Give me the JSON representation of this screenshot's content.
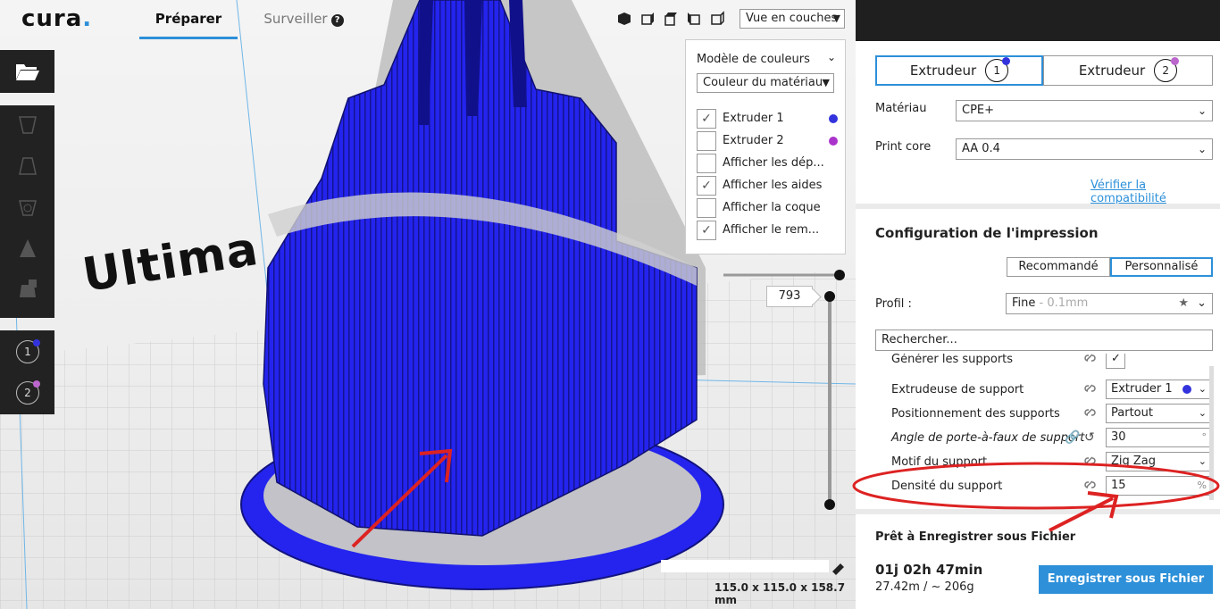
{
  "app": {
    "logo": "cura",
    "logo_dot": "."
  },
  "stages": {
    "prepare": "Préparer",
    "monitor": "Surveiller",
    "monitor_help": "?"
  },
  "view_mode": {
    "selected": "Vue en couches"
  },
  "viewport": {
    "model_text": "Ultima",
    "dimensions": "115.0 x 115.0 x 158.7 mm"
  },
  "left_toolbar": {
    "extruder_1": "1",
    "extruder_2": "2"
  },
  "color_panel": {
    "title": "Modèle de couleurs",
    "scheme": "Couleur du matériau",
    "items": [
      {
        "label": "Extruder 1",
        "checked": true,
        "mark": "✓",
        "color": "#3333dd"
      },
      {
        "label": "Extruder 2",
        "checked": false,
        "mark": "",
        "color": "#aa33cc"
      },
      {
        "label": "Afficher les dép...",
        "checked": false,
        "mark": ""
      },
      {
        "label": "Afficher les aides",
        "checked": true,
        "mark": "✓"
      },
      {
        "label": "Afficher la coque",
        "checked": false,
        "mark": ""
      },
      {
        "label": "Afficher le rem...",
        "checked": true,
        "mark": "✓"
      }
    ]
  },
  "layer_slider": {
    "current_layer": "793"
  },
  "extruders": {
    "tab1": {
      "label": "Extrudeur",
      "number": "1",
      "color": "#3333dd"
    },
    "tab2": {
      "label": "Extrudeur",
      "number": "2",
      "color": "#bb66cc"
    }
  },
  "material": {
    "label": "Matériau",
    "value": "CPE+"
  },
  "print_core": {
    "label": "Print core",
    "value": "AA 0.4"
  },
  "compat_link": "Vérifier la compatibilité",
  "print_setup": {
    "title": "Configuration de l'impression",
    "mode_recommended": "Recommandé",
    "mode_custom": "Personnalisé",
    "profile_label": "Profil :",
    "profile_value": "Fine",
    "profile_sub": " - 0.1mm",
    "search_placeholder": "Rechercher..."
  },
  "settings": [
    {
      "name": "Générer les supports",
      "value": "✓",
      "italic": false
    },
    {
      "name": "Extrudeuse de support",
      "value": "Extruder 1",
      "italic": false
    },
    {
      "name": "Positionnement des supports",
      "value": "Partout",
      "italic": false
    },
    {
      "name": "Angle de porte-à-faux de support",
      "value": "30",
      "unit": "°",
      "italic": true
    },
    {
      "name": "Motif du support",
      "value": "Zig Zag",
      "italic": false
    },
    {
      "name": "Densité du support",
      "value": "15",
      "unit": "%",
      "italic": false
    }
  ],
  "save": {
    "title": "Prêt à Enregistrer sous Fichier",
    "time": "01j 02h 47min",
    "material_used": "27.42m / ~ 206g",
    "button": "Enregistrer sous Fichier"
  },
  "colors": {
    "accent": "#2d90d9",
    "model_blue": "#2a2af0",
    "annotation_red": "#dd2222"
  }
}
